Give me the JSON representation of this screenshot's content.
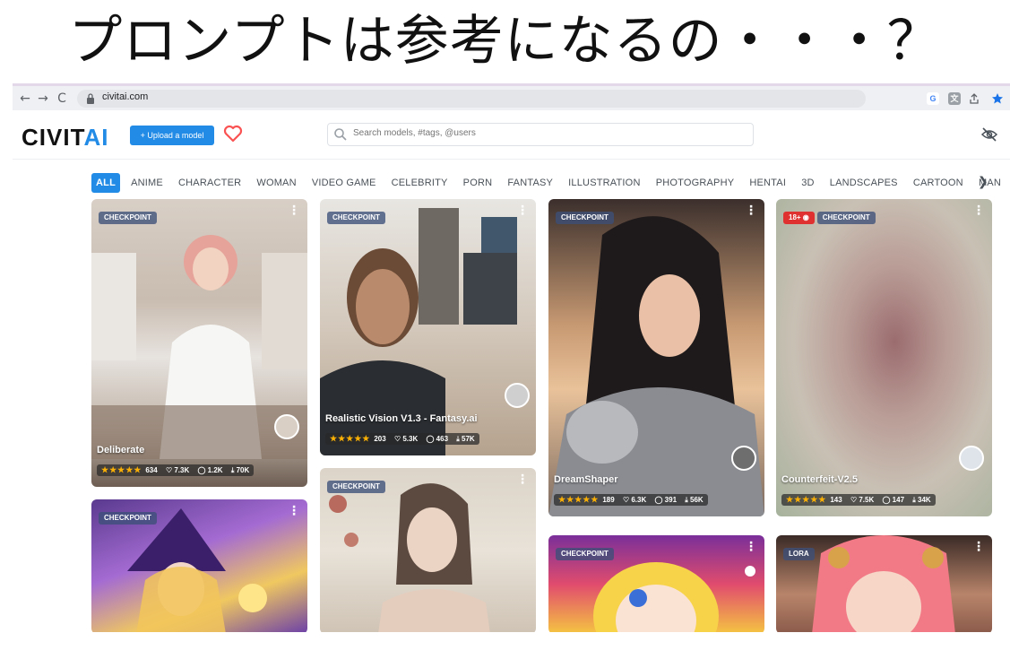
{
  "slide": {
    "title": "プロンプトは参考になるの・・・？"
  },
  "browser": {
    "back": "←",
    "forward": "→",
    "reload": "C",
    "url": "civitai.com"
  },
  "site": {
    "logo_part1": "CIVIT",
    "logo_part2": "AI",
    "upload_label": "+ Upload a model",
    "search_placeholder": "Search models, #tags, @users"
  },
  "categories": [
    "ALL",
    "ANIME",
    "CHARACTER",
    "WOMAN",
    "VIDEO GAME",
    "CELEBRITY",
    "PORN",
    "FANTASY",
    "ILLUSTRATION",
    "PHOTOGRAPHY",
    "HENTAI",
    "3D",
    "LANDSCAPES",
    "CARTOON",
    "MAN"
  ],
  "cards": [
    {
      "badge": "CHECKPOINT",
      "title": "Deliberate",
      "stars": "★★★★★",
      "rating_count": "634",
      "likes": "7.3K",
      "comments": "1.2K",
      "downloads": "70K"
    },
    {
      "badge": "CHECKPOINT",
      "title": "Realistic Vision V1.3 - Fantasy.ai",
      "stars": "★★★★★",
      "rating_count": "203",
      "likes": "5.3K",
      "comments": "463",
      "downloads": "57K"
    },
    {
      "badge": "CHECKPOINT",
      "title": "DreamShaper",
      "stars": "★★★★★",
      "rating_count": "189",
      "likes": "6.3K",
      "comments": "391",
      "downloads": "56K"
    },
    {
      "badge_nsfw": "18+",
      "badge": "CHECKPOINT",
      "title": "Counterfeit-V2.5",
      "stars": "★★★★★",
      "rating_count": "143",
      "likes": "7.5K",
      "comments": "147",
      "downloads": "34K"
    },
    {
      "badge": "CHECKPOINT"
    },
    {
      "badge": "CHECKPOINT"
    },
    {
      "badge": "CHECKPOINT"
    },
    {
      "badge": "LORA"
    }
  ],
  "colors": {
    "accent": "#228be6",
    "heart": "#fa5252",
    "stars": "#fab005",
    "nsfw": "#e03131"
  }
}
